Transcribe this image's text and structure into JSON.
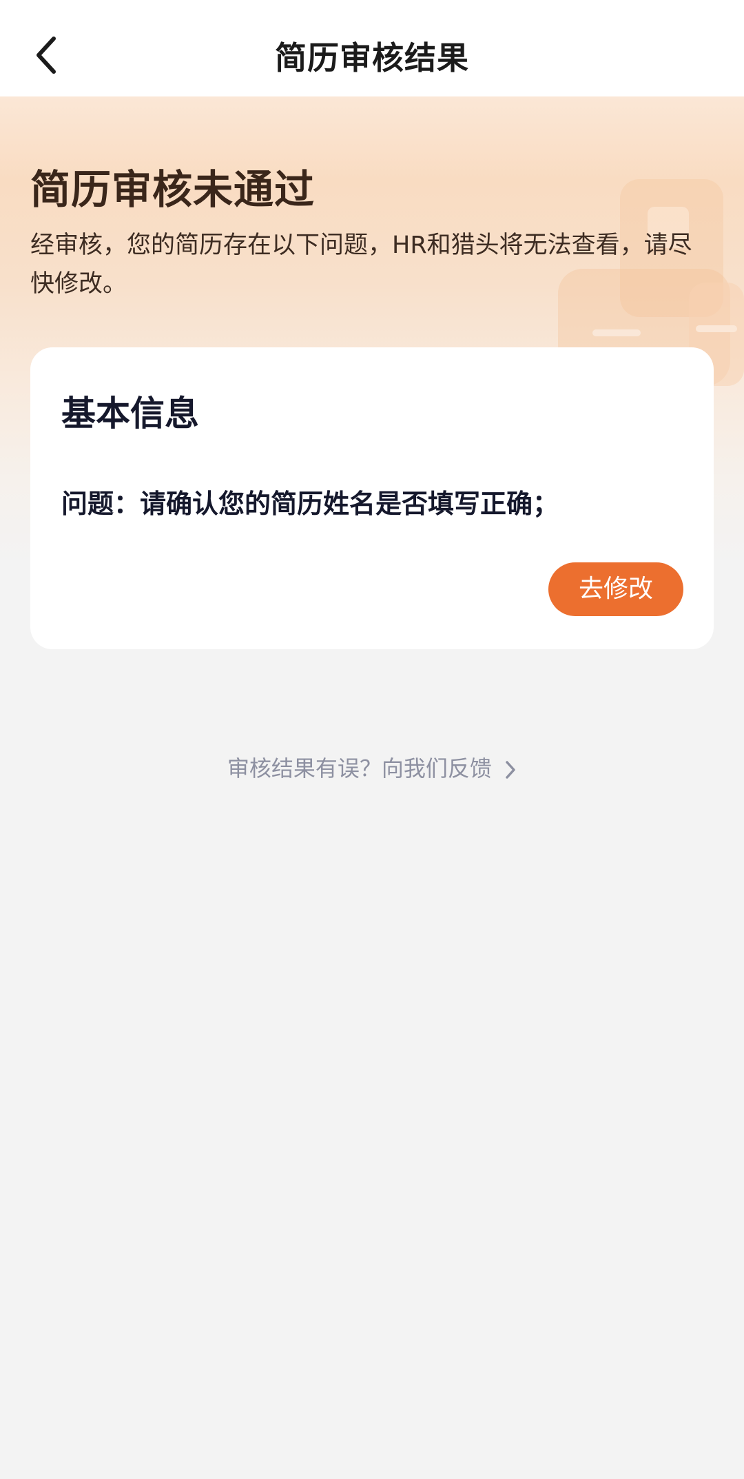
{
  "nav": {
    "title": "简历审核结果",
    "back_icon": "back-arrow-icon"
  },
  "hero": {
    "title": "简历审核未通过",
    "description": "经审核，您的简历存在以下问题，HR和猎头将无法查看，请尽快修改。"
  },
  "card": {
    "title": "基本信息",
    "issue": "问题：请确认您的简历姓名是否填写正确；",
    "edit_button_label": "去修改"
  },
  "feedback": {
    "label": "审核结果有误？向我们反馈",
    "icon": "chevron-right-icon"
  },
  "colors": {
    "accent": "#ec6f2f",
    "page_background": "#f3f3f3",
    "title_text": "#15182c",
    "feedback_text": "#8d90a1"
  }
}
